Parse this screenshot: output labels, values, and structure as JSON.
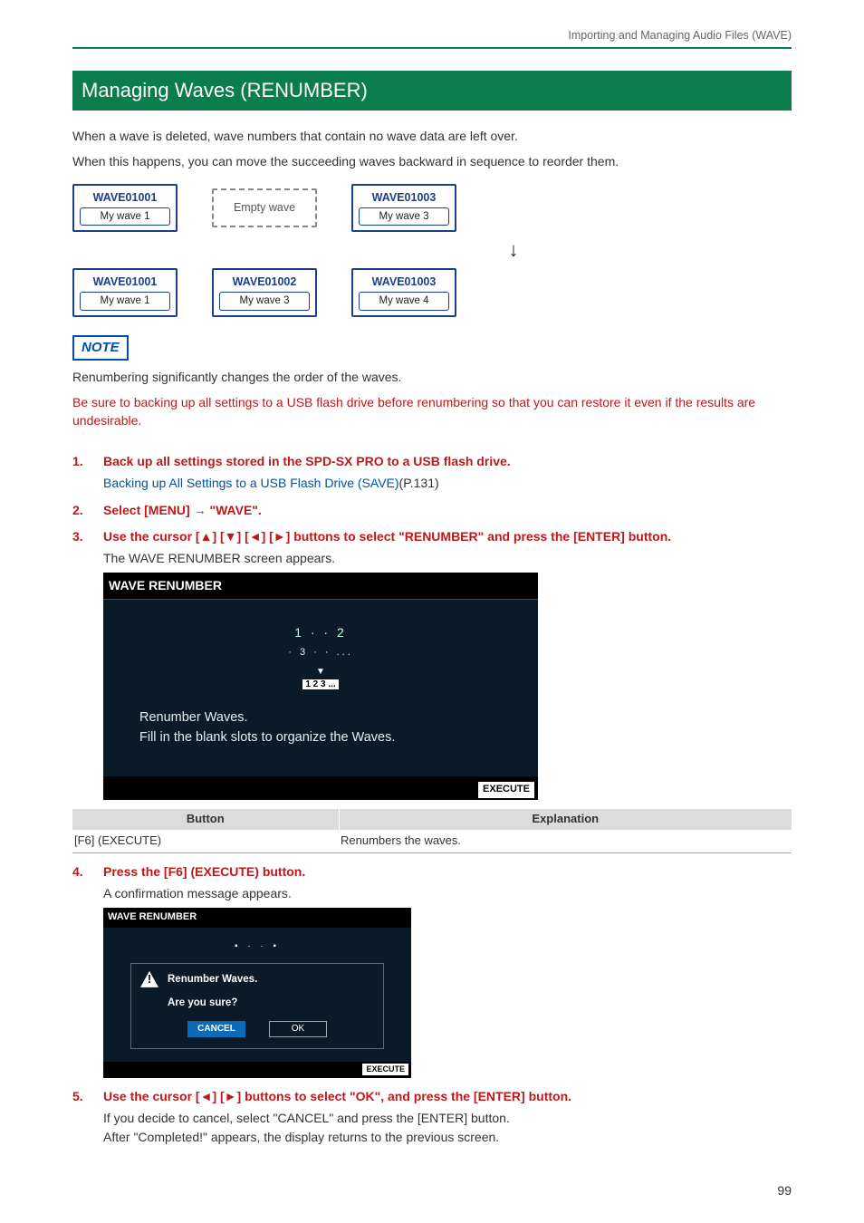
{
  "crumb": "Importing and Managing Audio Files (WAVE)",
  "h1": "Managing Waves (RENUMBER)",
  "intro1": "When a wave is deleted, wave numbers that contain no wave data are left over.",
  "intro2": "When this happens, you can move the succeeding waves backward in sequence to reorder them.",
  "diag": {
    "top": [
      {
        "name": "WAVE01001",
        "sub": "My wave 1"
      },
      {
        "name": "Empty wave",
        "empty": true
      },
      {
        "name": "WAVE01003",
        "sub": "My wave 3"
      }
    ],
    "bottom": [
      {
        "name": "WAVE01001",
        "sub": "My wave 1"
      },
      {
        "name": "WAVE01002",
        "sub": "My wave 3"
      },
      {
        "name": "WAVE01003",
        "sub": "My wave 4"
      }
    ]
  },
  "note_label": "NOTE",
  "note_line1": "Renumbering significantly changes the order of the waves.",
  "note_line2": "Be sure to backing up all settings to a USB flash drive before renumbering so that you can restore it even if the results are undesirable.",
  "steps": {
    "s1": {
      "num": "1.",
      "title": "Back up all settings stored in the SPD-SX PRO to a USB flash drive.",
      "link": "Backing up All Settings to a USB Flash Drive (SAVE)",
      "pageref": "(P.131)"
    },
    "s2": {
      "num": "2.",
      "title": "Select [MENU] → \"WAVE\"."
    },
    "s3": {
      "num": "3.",
      "title": "Use the cursor [▲] [▼] [◄] [►] buttons to select \"RENUMBER\" and press the [ENTER] button.",
      "body": "The WAVE RENUMBER screen appears."
    },
    "s4": {
      "num": "4.",
      "title": "Press the [F6] (EXECUTE) button.",
      "body": "A confirmation message appears."
    },
    "s5": {
      "num": "5.",
      "title": "Use the cursor [◄] [►] buttons to select \"OK\", and press the [ENTER] button.",
      "body1": "If you decide to cancel, select \"CANCEL\" and press the [ENTER] button.",
      "body2": "After \"Completed!\" appears, the display returns to the previous screen."
    }
  },
  "screen1": {
    "title": "WAVE RENUMBER",
    "iconA": "1 · · 2",
    "iconB": "· 3 · · ...",
    "iconC": "▼",
    "iconD": "1 2 3 ...",
    "line1": "Renumber Waves.",
    "line2": "Fill in the blank slots to organize the Waves.",
    "exec": "EXECUTE"
  },
  "table": {
    "h1": "Button",
    "h2": "Explanation",
    "r1c1": "[F6] (EXECUTE)",
    "r1c2": "Renumbers the waves."
  },
  "screen2": {
    "title": "WAVE RENUMBER",
    "line1": "Renumber Waves.",
    "line2": "Are you sure?",
    "cancel": "CANCEL",
    "ok": "OK",
    "exec": "EXECUTE"
  },
  "pagenum": "99"
}
